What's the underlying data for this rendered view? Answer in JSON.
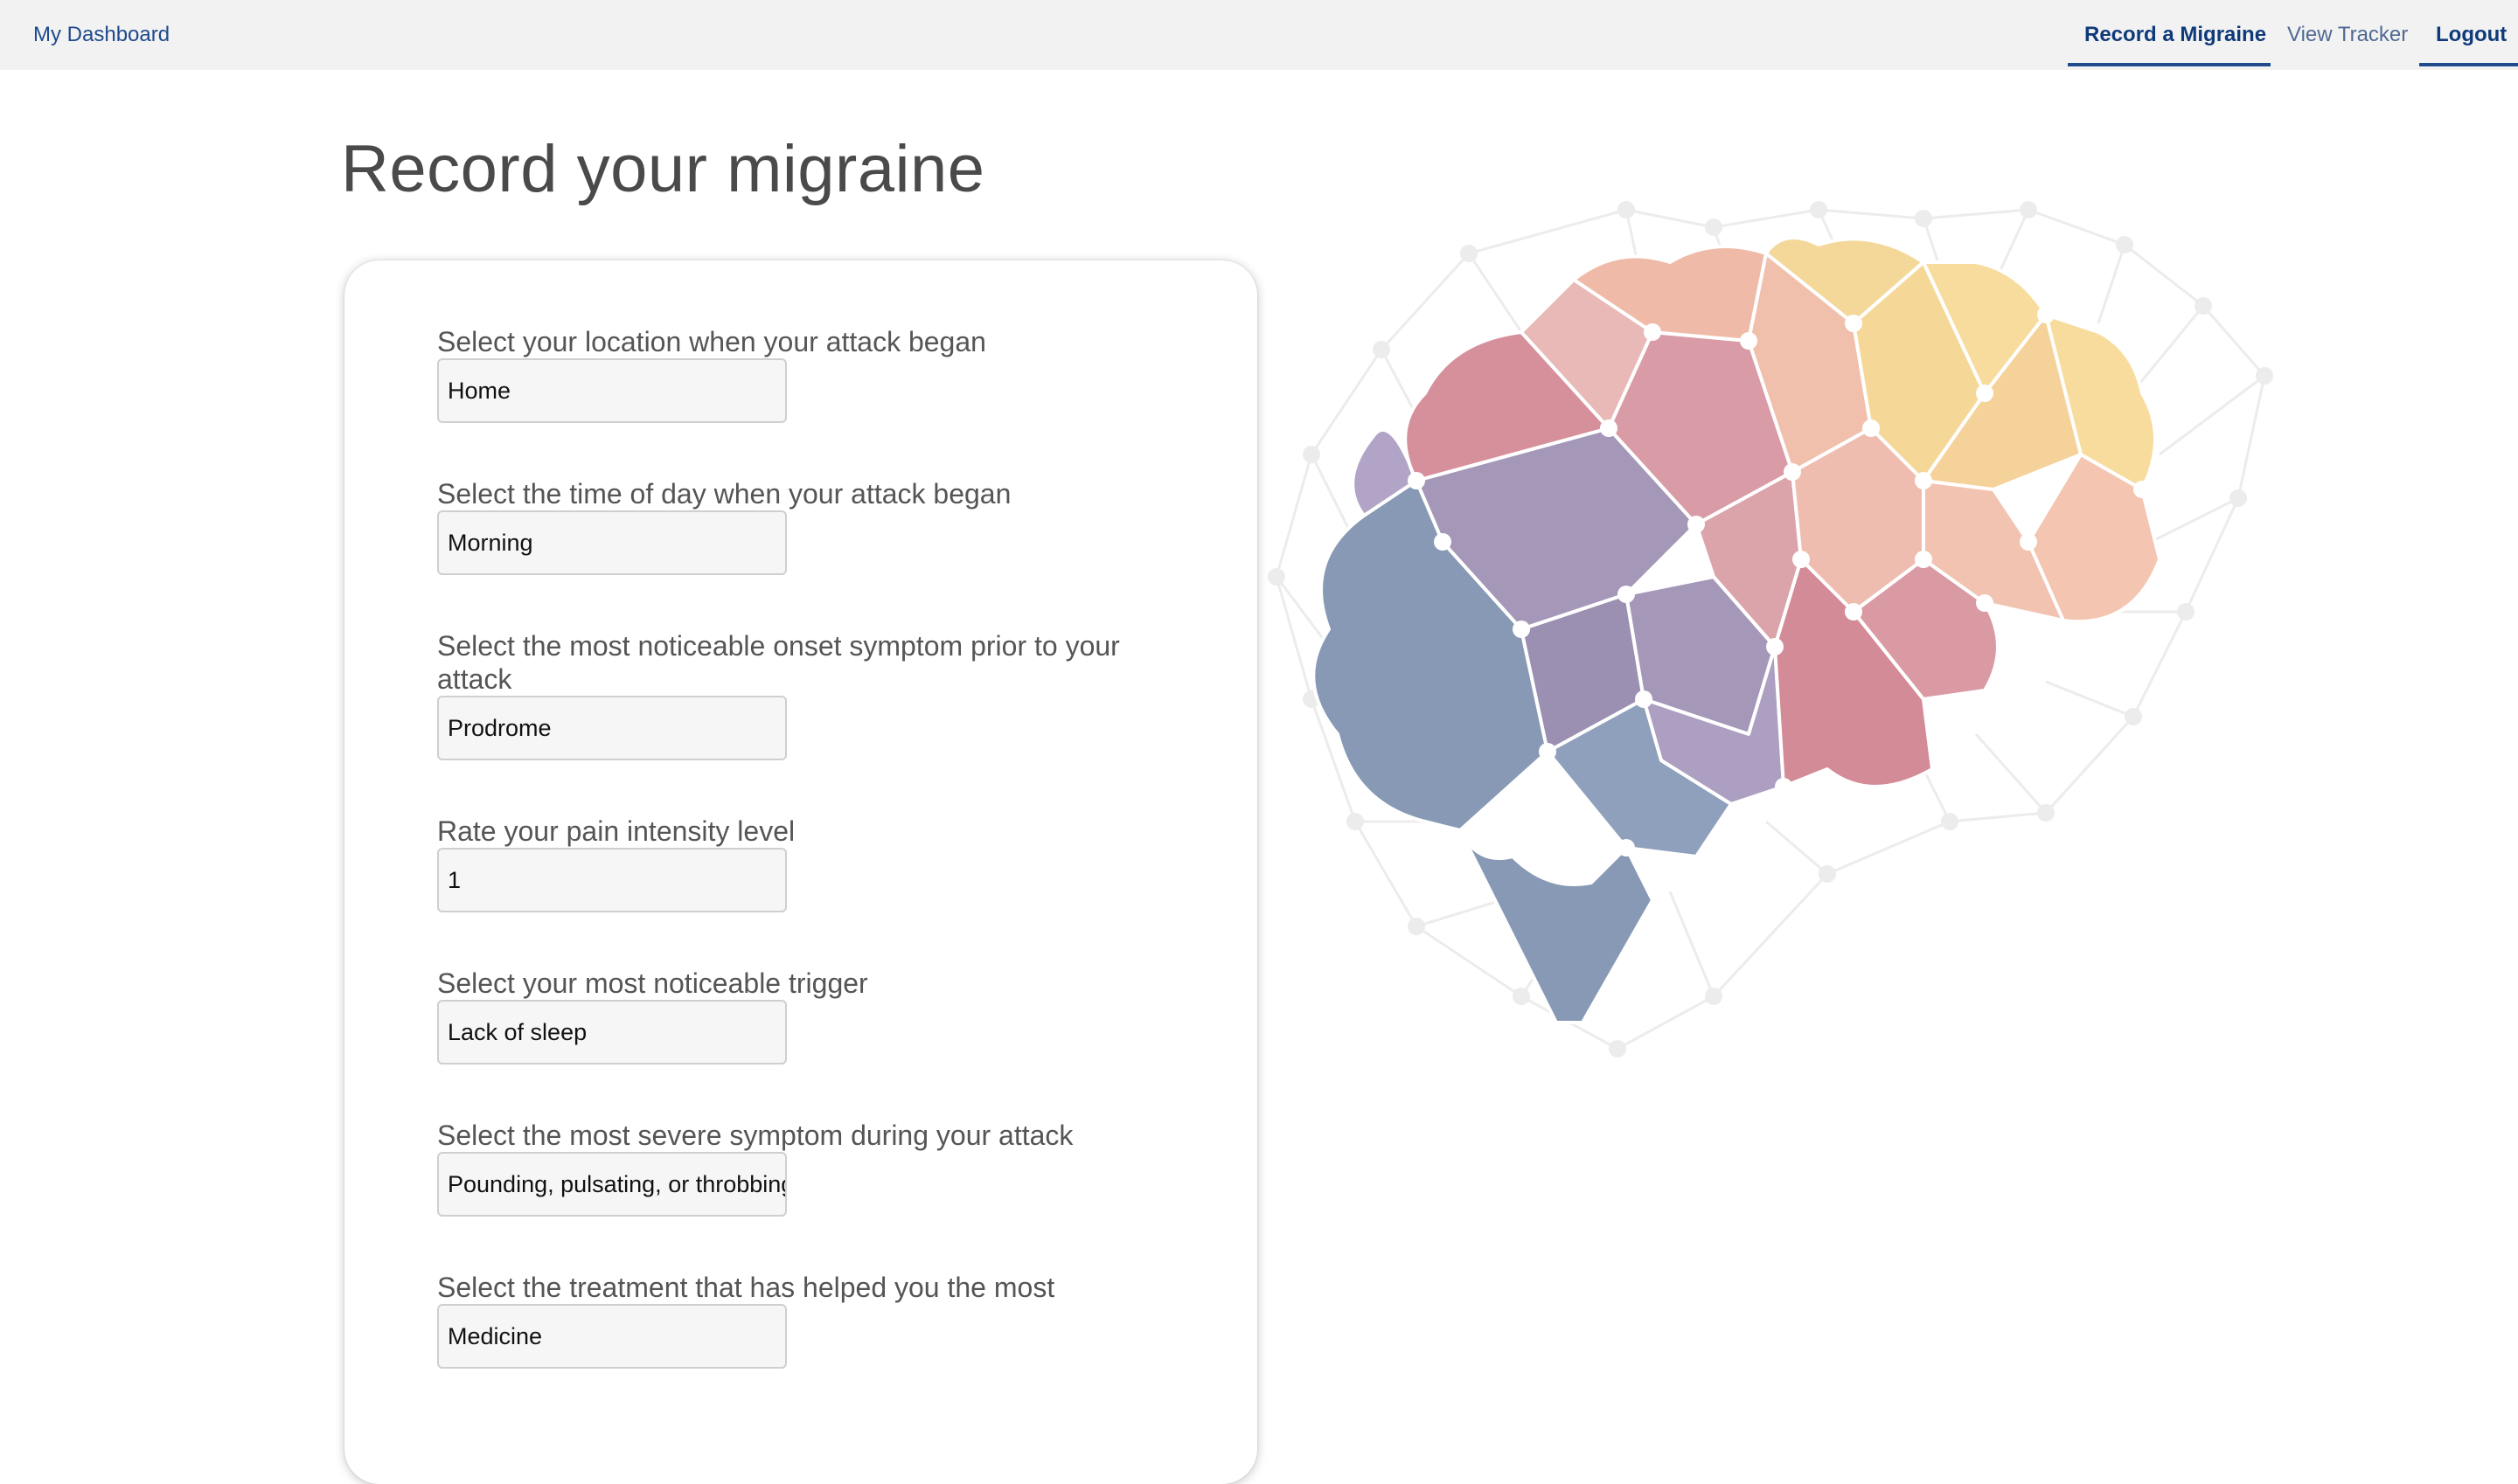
{
  "nav": {
    "brand": "My Dashboard",
    "record_link": "Record a Migraine",
    "tracker_link": "View Tracker",
    "logout_link": "Logout"
  },
  "page": {
    "title": "Record your migraine"
  },
  "form": {
    "fields": [
      {
        "label": "Select your location when your attack began",
        "value": "Home"
      },
      {
        "label": "Select the time of day when your attack began",
        "value": "Morning"
      },
      {
        "label": "Select the most noticeable onset symptom prior to your attack",
        "value": "Prodrome"
      },
      {
        "label": "Rate your pain intensity level",
        "value": "1"
      },
      {
        "label": "Select your most noticeable trigger",
        "value": "Lack of sleep"
      },
      {
        "label": "Select the most severe symptom during your attack",
        "value": "Pounding, pulsating, or throbbing"
      },
      {
        "label": "Select the treatment that has helped you the most",
        "value": "Medicine"
      }
    ]
  },
  "colors": {
    "nav_bg": "#f2f2f2",
    "nav_active": "#1f4a8c",
    "brain_blue": "#8799b4",
    "brain_purple": "#a597b8",
    "brain_rose": "#d6909c",
    "brain_peach": "#efbba8",
    "brain_yellow": "#f5d898"
  }
}
